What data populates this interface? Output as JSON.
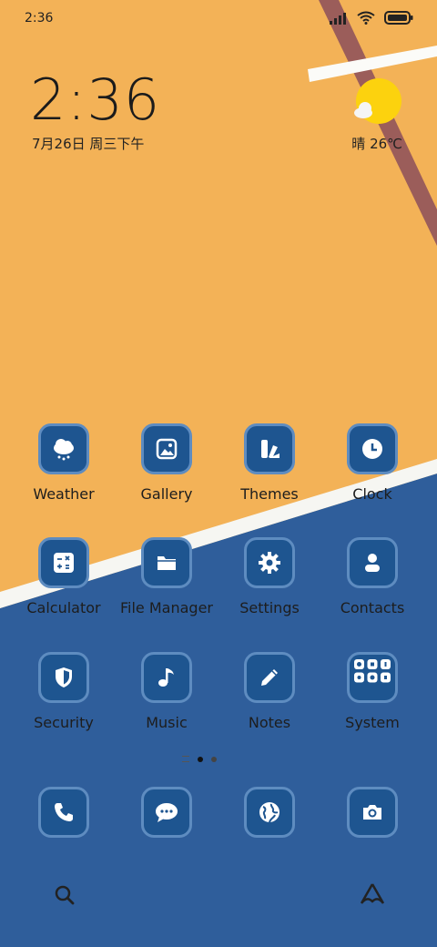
{
  "status_bar": {
    "time": "2:36"
  },
  "lock_widget": {
    "time": "2:36",
    "date": "7月26日 周三下午"
  },
  "weather_widget": {
    "text": "晴 26℃",
    "icon": "sun-cloud-icon"
  },
  "apps": [
    {
      "label": "Weather",
      "icon": "cloud-snow-icon"
    },
    {
      "label": "Gallery",
      "icon": "image-icon"
    },
    {
      "label": "Themes",
      "icon": "palette-icon"
    },
    {
      "label": "Clock",
      "icon": "clock-icon"
    },
    {
      "label": "Calculator",
      "icon": "calculator-icon"
    },
    {
      "label": "File Manager",
      "icon": "folder-icon"
    },
    {
      "label": "Settings",
      "icon": "gear-icon"
    },
    {
      "label": "Contacts",
      "icon": "person-icon"
    },
    {
      "label": "Security",
      "icon": "shield-icon"
    },
    {
      "label": "Music",
      "icon": "music-note-icon"
    },
    {
      "label": "Notes",
      "icon": "pencil-icon"
    },
    {
      "label": "System",
      "icon": "folder-grid-icon"
    }
  ],
  "dock": [
    {
      "icon": "phone-icon"
    },
    {
      "icon": "message-icon"
    },
    {
      "icon": "globe-icon"
    },
    {
      "icon": "camera-icon"
    }
  ],
  "colors": {
    "court_orange": "#f2b054",
    "court_blue": "#2e5d99",
    "tile": "#1e5590"
  }
}
